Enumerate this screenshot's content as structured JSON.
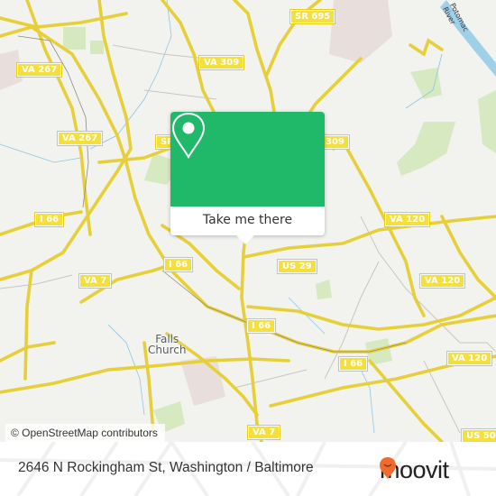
{
  "map": {
    "road_labels": [
      {
        "id": "sr695",
        "text": "SR 695"
      },
      {
        "id": "va267a",
        "text": "VA 267"
      },
      {
        "id": "va309a",
        "text": "VA 309"
      },
      {
        "id": "va267b",
        "text": "VA 267"
      },
      {
        "id": "sr-partial",
        "text": "SR"
      },
      {
        "id": "va309-partial",
        "text": "309"
      },
      {
        "id": "i66a",
        "text": "I 66"
      },
      {
        "id": "va120a",
        "text": "VA 120"
      },
      {
        "id": "i66b",
        "text": "I 66"
      },
      {
        "id": "us29",
        "text": "US 29"
      },
      {
        "id": "va7a",
        "text": "VA 7"
      },
      {
        "id": "va120b",
        "text": "VA 120"
      },
      {
        "id": "i66c",
        "text": "I 66"
      },
      {
        "id": "i66d",
        "text": "I 66"
      },
      {
        "id": "va120c",
        "text": "VA 120"
      },
      {
        "id": "va7b",
        "text": "VA 7"
      },
      {
        "id": "us50",
        "text": "US 50"
      }
    ],
    "place_label": {
      "line1": "Falls",
      "line2": "Church"
    },
    "river_label": "Potomac River",
    "attribution": "© OpenStreetMap contributors"
  },
  "popup": {
    "icon": "map-pin-icon",
    "button_label": "Take me there",
    "color": "#20b96a"
  },
  "footer": {
    "address": "2646 N Rockingham St, Washington / Baltimore",
    "brand": "moovit",
    "brand_color": "#f26b2e"
  }
}
